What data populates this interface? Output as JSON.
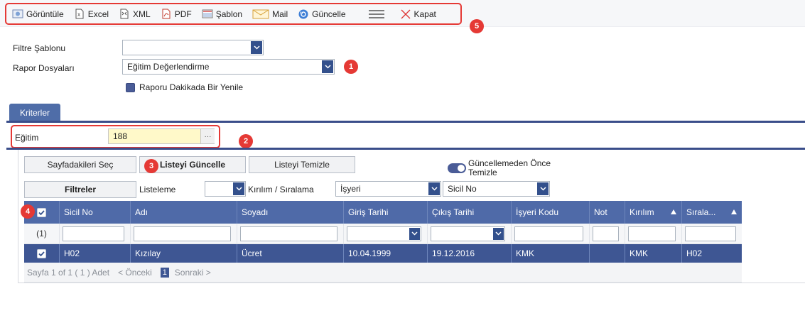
{
  "toolbar": {
    "items": [
      {
        "label": "Görüntüle",
        "icon": "view-icon"
      },
      {
        "label": "Excel",
        "icon": "excel-icon"
      },
      {
        "label": "XML",
        "icon": "xml-icon"
      },
      {
        "label": "PDF",
        "icon": "pdf-icon"
      },
      {
        "label": "Şablon",
        "icon": "template-icon"
      },
      {
        "label": "Mail",
        "icon": "mail-icon"
      },
      {
        "label": "Güncelle",
        "icon": "refresh-icon"
      },
      {
        "label": "",
        "icon": "menu-icon"
      },
      {
        "label": "Kapat",
        "icon": "close-icon"
      }
    ]
  },
  "badges": {
    "b1": "1",
    "b2": "2",
    "b3": "3",
    "b4": "4",
    "b5": "5"
  },
  "form": {
    "filter_template_label": "Filtre Şablonu",
    "filter_template_value": "",
    "report_files_label": "Rapor Dosyaları",
    "report_files_value": "Eğitim Değerlendirme",
    "refresh_checkbox_label": "Raporu Dakikada Bir Yenile"
  },
  "tab": {
    "label": "Kriterler"
  },
  "criteria": {
    "egitim_label": "Eğitim",
    "egitim_value": "188",
    "dots": "···"
  },
  "actions": {
    "select_page": "Sayfadakileri Seç",
    "update_list": "Listeyi Güncelle",
    "clear_list": "Listeyi Temizle",
    "clear_before_update": "Güncellemeden Önce Temizle",
    "filters": "Filtreler",
    "listing_label": "Listeleme",
    "listing_value": "",
    "breakdown_label": "Kırılım / Sıralama",
    "breakdown_value": "İşyeri",
    "sort_value": "Sicil No"
  },
  "grid": {
    "columns": [
      "",
      "Sicil No",
      "Adı",
      "Soyadı",
      "Giriş Tarihi",
      "Çıkış Tarihi",
      "İşyeri Kodu",
      "Not",
      "Kırılım",
      "Sırala..."
    ],
    "row_count_label": "(1)",
    "rows": [
      {
        "sicil": "H02",
        "adi": "Kızılay",
        "soyadi": "Ücret",
        "giris": "10.04.1999",
        "cikis": "19.12.2016",
        "isyeri": "KMK",
        "not": "",
        "kirilim": "KMK",
        "sirala": "H02"
      }
    ]
  },
  "pager": {
    "summary": "Sayfa 1 of 1 ( 1 ) Adet",
    "prev": "< Önceki",
    "current": "1",
    "next": "Sonraki >"
  },
  "colors": {
    "accent": "#4f6aa8",
    "row_selected": "#3e5693",
    "callout": "#e53935"
  }
}
